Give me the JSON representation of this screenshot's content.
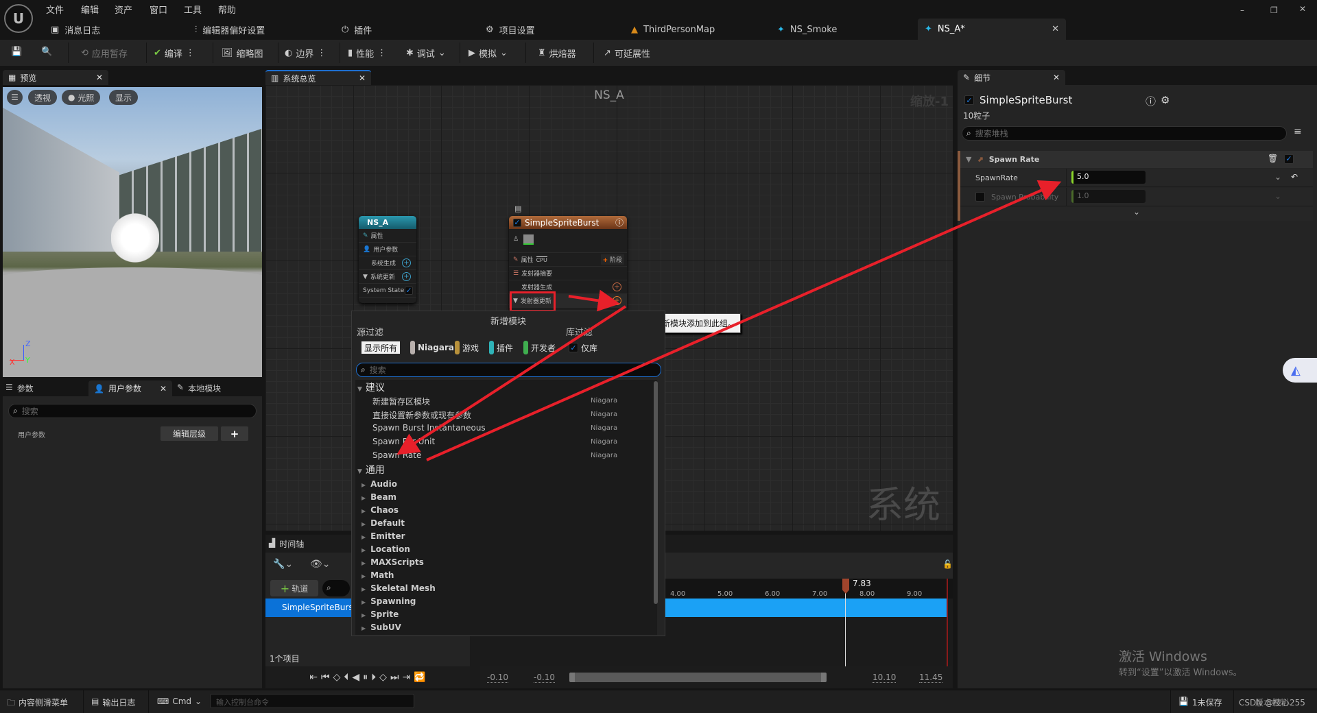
{
  "menu": [
    "文件",
    "编辑",
    "资产",
    "窗口",
    "工具",
    "帮助"
  ],
  "doc_tabs": [
    {
      "label": "消息日志",
      "icon": "message-log-icon"
    },
    {
      "label": "编辑器偏好设置",
      "icon": "sliders-icon"
    },
    {
      "label": "插件",
      "icon": "plugin-icon"
    },
    {
      "label": "项目设置",
      "icon": "project-settings-icon"
    },
    {
      "label": "ThirdPersonMap",
      "icon": "level-icon"
    },
    {
      "label": "NS_Smoke",
      "icon": "niagara-system-icon"
    },
    {
      "label": "NS_A*",
      "icon": "niagara-system-icon",
      "active": true
    }
  ],
  "toolbar": {
    "apply": "应用暂存",
    "compile": "编译",
    "thumbnail": "缩略图",
    "bounds": "边界",
    "perf": "性能",
    "debug": "调试",
    "simulate": "模拟",
    "baker": "烘焙器",
    "scalability": "可延展性"
  },
  "preview": {
    "tab": "预览",
    "perspective": "透视",
    "lit": "光照",
    "show": "显示",
    "axis_x": "X",
    "axis_y": "Y",
    "axis_z": "Z"
  },
  "params": {
    "tabs": [
      "参数",
      "用户参数",
      "本地模块"
    ],
    "search_placeholder": "搜索",
    "row_label": "用户参数",
    "edit_hierarchy": "编辑层级",
    "add": "+"
  },
  "overview": {
    "tab": "系统总览",
    "title": "NS_A",
    "zoom": "缩放-1",
    "watermark": "系统"
  },
  "system_node": {
    "title": "NS_A",
    "rows": [
      "属性",
      "用户参数",
      "系统生成",
      "系统更新",
      "System State"
    ]
  },
  "emitter_node": {
    "title": "SimpleSpriteBurst",
    "props": "属性",
    "cpu": "CPU",
    "stage": "阶段",
    "summary": "发射器摘要",
    "spawn": "发射器生成",
    "update": "发射器更新"
  },
  "tooltip": "将一个新模块添加到此组。",
  "add_module": {
    "title": "新增模块",
    "source_filter": "源过滤",
    "library_filter": "库过滤",
    "chips": [
      {
        "label": "显示所有"
      },
      {
        "label": "Niagara",
        "color": "#b8b0ad"
      },
      {
        "label": "游戏",
        "color": "#b8913b"
      },
      {
        "label": "插件",
        "color": "#2fb3b8"
      },
      {
        "label": "开发者",
        "color": "#3fae4f"
      }
    ],
    "library_only": "仅库",
    "search_placeholder": "搜索",
    "suggested_label": "建议",
    "suggested": [
      {
        "name": "新建暂存区模块",
        "src": "Niagara"
      },
      {
        "name": "直接设置新参数或现有参数",
        "src": "Niagara"
      },
      {
        "name": "Spawn Burst Instantaneous",
        "src": "Niagara"
      },
      {
        "name": "Spawn Per Unit",
        "src": "Niagara"
      },
      {
        "name": "Spawn Rate",
        "src": "Niagara"
      }
    ],
    "general_label": "通用",
    "categories": [
      "Audio",
      "Beam",
      "Chaos",
      "Default",
      "Emitter",
      "Location",
      "MAXScripts",
      "Math",
      "Skeletal Mesh",
      "Spawning",
      "Sprite",
      "SubUV"
    ]
  },
  "timeline": {
    "tab": "时间轴",
    "add_track": "轨道",
    "track": "SimpleSpriteBurst",
    "count": "1个项目",
    "ruler": [
      "4.00",
      "5.00",
      "6.00",
      "7.00",
      "8.00",
      "9.00"
    ],
    "playhead": "7.83",
    "view_start": "-0.10",
    "work_start": "-0.10",
    "work_end": "10.10",
    "view_end": "11.45"
  },
  "details": {
    "tab": "细节",
    "emitter": "SimpleSpriteBurst",
    "particles": "10粒子",
    "search_placeholder": "搜索堆栈",
    "module": "Spawn Rate",
    "rows": [
      {
        "label": "SpawnRate",
        "value": "5.0"
      },
      {
        "label": "Spawn Probability",
        "value": "1.0"
      }
    ]
  },
  "statusbar": {
    "content_drawer": "内容侧滑菜单",
    "output_log": "输出日志",
    "cmd": "Cmd",
    "console_placeholder": "输入控制台命令",
    "unsaved": "1未保存",
    "source_control": "版本控制"
  },
  "watermark": {
    "line1": "激活 Windows",
    "line2": "转到“设置”以激活 Windows。",
    "csdn": "CSDN @枝心255"
  },
  "colors": {
    "accent": "#1e8ef0",
    "emitter": "#a2592b",
    "system": "#1c7f93",
    "arrow": "#e8202a",
    "track": "#1ba1f5"
  }
}
